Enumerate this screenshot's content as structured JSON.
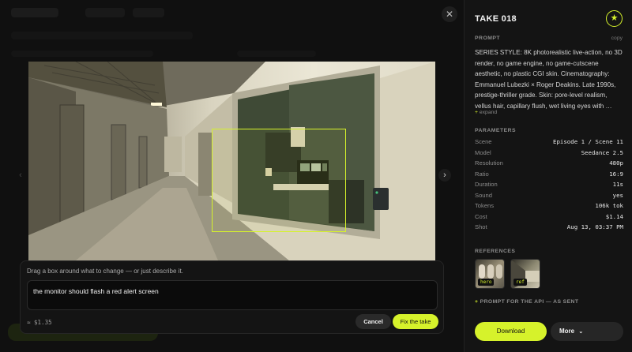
{
  "viewer": {
    "close_glyph": "✕",
    "prev_glyph": "‹",
    "next_glyph": "›"
  },
  "edit": {
    "hint": "Drag a box around what to change — or just describe it.",
    "input_value": "the monitor should flash a red alert screen",
    "cost": "≈ $1.35",
    "cancel_label": "Cancel",
    "fix_label": "Fix the take"
  },
  "panel": {
    "title": "TAKE 018",
    "fav_glyph": "★",
    "prompt_label": "PROMPT",
    "copy_label": "copy",
    "prompt_text": "SERIES STYLE: 8K photorealistic live-action, no 3D render, no game engine, no game-cutscene aesthetic, no plastic CGI skin. Cinematography: Emmanuel Lubezki × Roger Deakins. Late 1990s, prestige-thriller grade. Skin: pore-level realism, vellus hair, capillary flush, wet living eyes with …",
    "expand_label": "expand",
    "params_label": "PARAMETERS",
    "params": [
      {
        "key": "Scene",
        "value": "Episode 1 / Scene 11"
      },
      {
        "key": "Model",
        "value": "Seedance 2.5"
      },
      {
        "key": "Resolution",
        "value": "480p"
      },
      {
        "key": "Ratio",
        "value": "16:9"
      },
      {
        "key": "Duration",
        "value": "11s"
      },
      {
        "key": "Sound",
        "value": "yes"
      },
      {
        "key": "Tokens",
        "value": "106k tok"
      },
      {
        "key": "Cost",
        "value": "$1.14"
      },
      {
        "key": "Shot",
        "value": "Aug 13, 03:37 PM"
      }
    ],
    "refs_label": "REFERENCES",
    "refs": [
      {
        "tag": "hero"
      },
      {
        "tag": "ref"
      }
    ],
    "api_label": "PROMPT FOR THE API — AS SENT",
    "download_label": "Download",
    "more_label": "More"
  },
  "colors": {
    "accent": "#d6f22b",
    "panel_bg": "#141414",
    "page_bg": "#0b0b0b"
  }
}
